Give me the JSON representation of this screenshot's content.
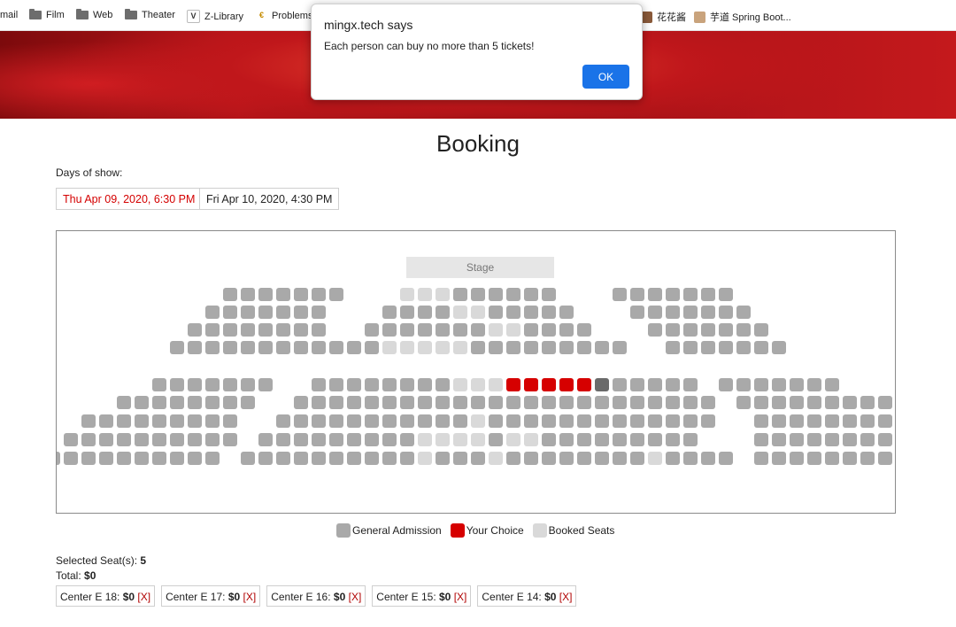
{
  "bookmarks": [
    {
      "label": "mail",
      "icon": "none"
    },
    {
      "label": "Film",
      "icon": "folder-icon"
    },
    {
      "label": "Web",
      "icon": "folder-icon"
    },
    {
      "label": "Theater",
      "icon": "folder-icon"
    },
    {
      "label": "Z-Library",
      "icon": "zlibrary-icon"
    },
    {
      "label": "Problems",
      "icon": "problems-icon"
    },
    {
      "label": "花花酱",
      "icon": "avatar-icon"
    },
    {
      "label": "芋道 Spring Boot...",
      "icon": "avatar-icon"
    }
  ],
  "dialog": {
    "title": "mingx.tech says",
    "message": "Each person can buy no more than 5 tickets!",
    "ok_label": "OK"
  },
  "page": {
    "title": "Booking",
    "days_label": "Days of show:",
    "dates": [
      {
        "label": "Thu Apr 09, 2020, 6:30 PM",
        "active": true
      },
      {
        "label": "Fri Apr 10, 2020, 4:30 PM",
        "active": false
      }
    ]
  },
  "seatmap": {
    "stage_label": "Stage",
    "colors": {
      "general": "#a9a9a9",
      "chosen": "#d60000",
      "booked": "#d9d9d9",
      "hover": "#6a6a6a"
    }
  },
  "legend": {
    "general": "General Admission",
    "choice": "Your Choice",
    "booked": "Booked Seats"
  },
  "summary": {
    "selected_label": "Selected Seat(s):",
    "selected_count": "5",
    "total_label": "Total:",
    "total_value": "$0"
  },
  "selected_seats": [
    {
      "name": "Center E 18:",
      "price": "$0",
      "remove": "[X]"
    },
    {
      "name": "Center E 17:",
      "price": "$0",
      "remove": "[X]"
    },
    {
      "name": "Center E 16:",
      "price": "$0",
      "remove": "[X]"
    },
    {
      "name": "Center E 15:",
      "price": "$0",
      "remove": "[X]"
    },
    {
      "name": "Center E 14:",
      "price": "$0",
      "remove": "[X]"
    }
  ]
}
